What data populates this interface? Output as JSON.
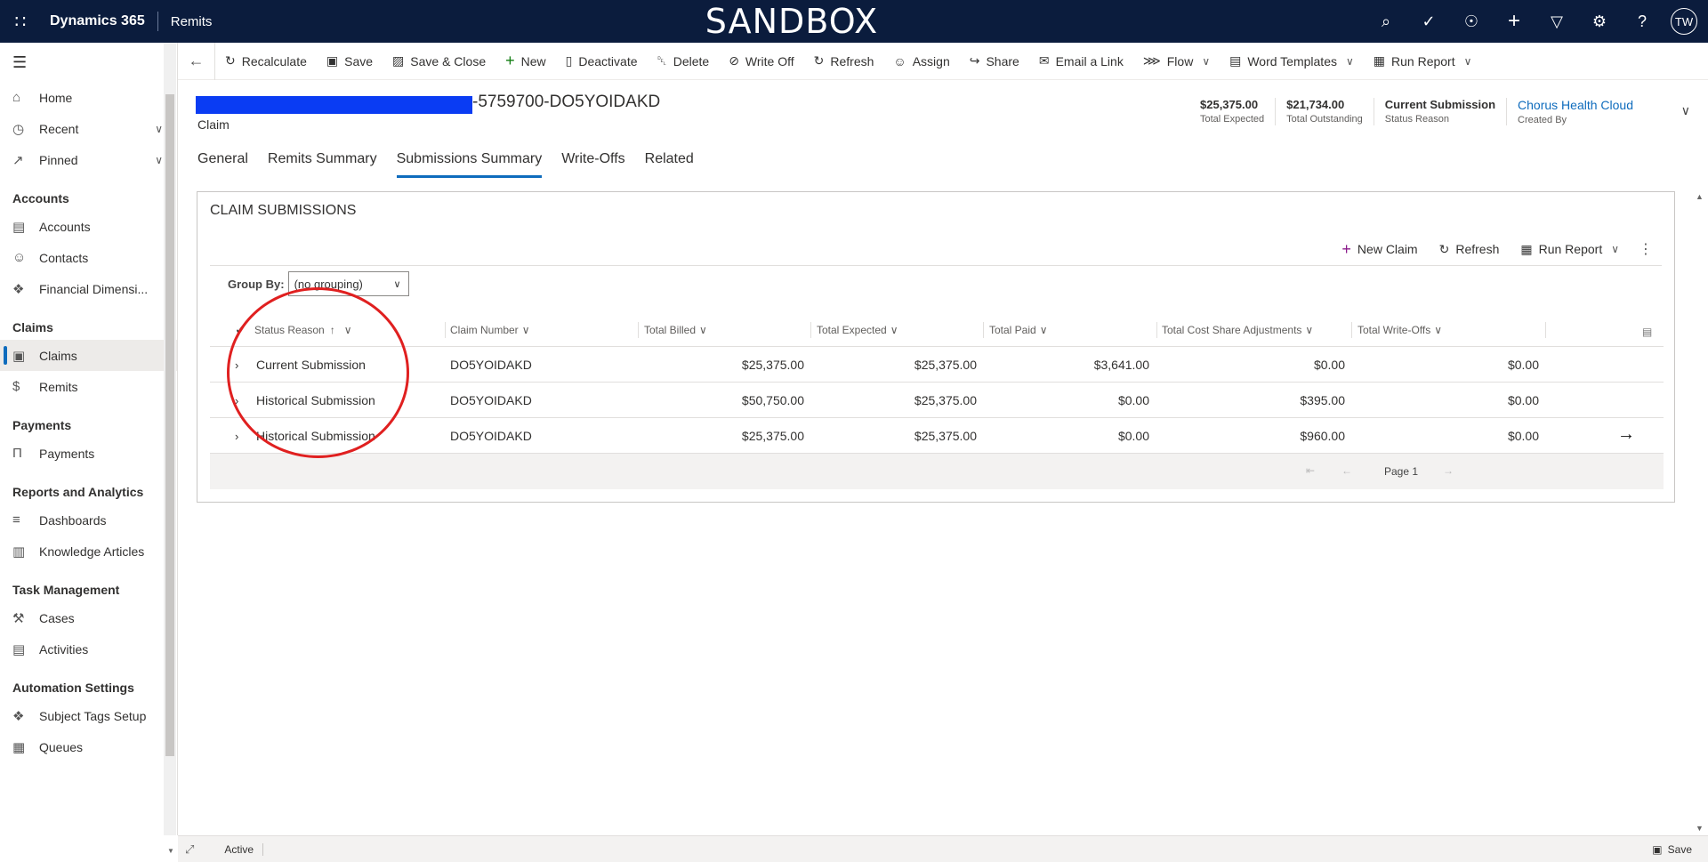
{
  "topbar": {
    "brand": "Dynamics 365",
    "app_name": "Remits",
    "environment_banner": "SANDBOX",
    "user_initials": "TW",
    "icons": [
      "search-icon",
      "task-icon",
      "lightbulb-icon",
      "plus-icon",
      "filter-icon",
      "gear-icon",
      "help-icon"
    ]
  },
  "sidebar": {
    "items": [
      {
        "label": "Home",
        "icon": "home-icon"
      },
      {
        "label": "Recent",
        "icon": "clock-icon",
        "expandable": true
      },
      {
        "label": "Pinned",
        "icon": "pin-icon",
        "expandable": true
      }
    ],
    "groups": [
      {
        "title": "Accounts",
        "items": [
          {
            "label": "Accounts",
            "icon": "building-icon"
          },
          {
            "label": "Contacts",
            "icon": "person-icon"
          },
          {
            "label": "Financial Dimensi...",
            "icon": "puzzle-icon"
          }
        ]
      },
      {
        "title": "Claims",
        "items": [
          {
            "label": "Claims",
            "icon": "claim-icon",
            "selected": true
          },
          {
            "label": "Remits",
            "icon": "money-icon"
          }
        ]
      },
      {
        "title": "Payments",
        "items": [
          {
            "label": "Payments",
            "icon": "payment-icon"
          }
        ]
      },
      {
        "title": "Reports and Analytics",
        "items": [
          {
            "label": "Dashboards",
            "icon": "dashboard-icon"
          },
          {
            "label": "Knowledge Articles",
            "icon": "article-icon"
          }
        ]
      },
      {
        "title": "Task Management",
        "items": [
          {
            "label": "Cases",
            "icon": "wrench-icon"
          },
          {
            "label": "Activities",
            "icon": "clipboard-icon"
          }
        ]
      },
      {
        "title": "Automation Settings",
        "items": [
          {
            "label": "Subject Tags Setup",
            "icon": "puzzle-icon"
          },
          {
            "label": "Queues",
            "icon": "queue-icon"
          }
        ]
      }
    ]
  },
  "commandbar": {
    "commands": [
      {
        "label": "Recalculate",
        "icon": "recalculate-icon"
      },
      {
        "label": "Save",
        "icon": "save-icon"
      },
      {
        "label": "Save & Close",
        "icon": "save-close-icon"
      },
      {
        "label": "New",
        "icon": "plus-icon"
      },
      {
        "label": "Deactivate",
        "icon": "deactivate-icon"
      },
      {
        "label": "Delete",
        "icon": "trash-icon"
      },
      {
        "label": "Write Off",
        "icon": "write-off-icon"
      },
      {
        "label": "Refresh",
        "icon": "refresh-icon"
      },
      {
        "label": "Assign",
        "icon": "assign-icon"
      },
      {
        "label": "Share",
        "icon": "share-icon"
      },
      {
        "label": "Email a Link",
        "icon": "email-icon"
      },
      {
        "label": "Flow",
        "icon": "flow-icon",
        "dropdown": true
      },
      {
        "label": "Word Templates",
        "icon": "word-icon",
        "dropdown": true
      },
      {
        "label": "Run Report",
        "icon": "report-icon",
        "dropdown": true
      }
    ]
  },
  "record": {
    "title_suffix": "-5759700-DO5YOIDAKD",
    "entity": "Claim",
    "header_fields": [
      {
        "value": "$25,375.00",
        "label": "Total Expected"
      },
      {
        "value": "$21,734.00",
        "label": "Total Outstanding"
      },
      {
        "value": "Current Submission",
        "label": "Status Reason"
      },
      {
        "value": "Chorus Health Cloud",
        "label": "Created By",
        "link": true
      }
    ]
  },
  "tabs": [
    {
      "label": "General"
    },
    {
      "label": "Remits Summary"
    },
    {
      "label": "Submissions Summary",
      "active": true
    },
    {
      "label": "Write-Offs"
    },
    {
      "label": "Related"
    }
  ],
  "subgrid": {
    "title": "CLAIM SUBMISSIONS",
    "commands": [
      {
        "label": "New Claim",
        "icon": "plus-icon"
      },
      {
        "label": "Refresh",
        "icon": "refresh-icon"
      },
      {
        "label": "Run Report",
        "icon": "report-icon",
        "dropdown": true
      }
    ],
    "group_by_label": "Group By:",
    "group_by_value": "(no grouping)",
    "columns": [
      "Status Reason",
      "Claim Number",
      "Total Billed",
      "Total Expected",
      "Total Paid",
      "Total Cost Share Adjustments",
      "Total Write-Offs"
    ],
    "rows": [
      [
        "Current Submission",
        "DO5YOIDAKD",
        "$25,375.00",
        "$25,375.00",
        "$3,641.00",
        "$0.00",
        "$0.00"
      ],
      [
        "Historical Submission",
        "DO5YOIDAKD",
        "$50,750.00",
        "$25,375.00",
        "$0.00",
        "$395.00",
        "$0.00"
      ],
      [
        "Historical Submission",
        "DO5YOIDAKD",
        "$25,375.00",
        "$25,375.00",
        "$0.00",
        "$960.00",
        "$0.00"
      ]
    ],
    "page_label": "Page 1",
    "annotation_color": "#e02020"
  },
  "statusbar": {
    "status": "Active",
    "save_label": "Save"
  },
  "colors": {
    "topbar": "#0b1c3d",
    "accent": "#0f6cbd",
    "redaction": "#0a3cf3"
  }
}
